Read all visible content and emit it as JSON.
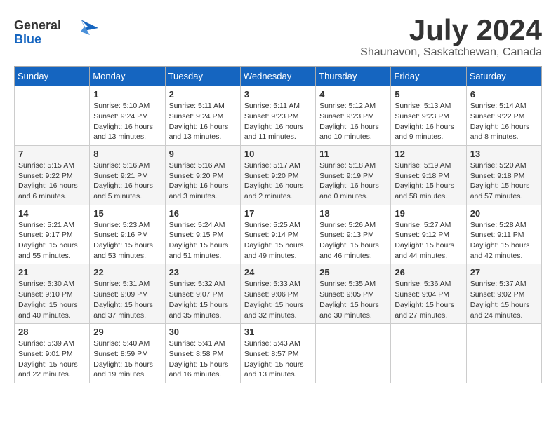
{
  "header": {
    "logo_line1": "General",
    "logo_line2": "Blue",
    "month": "July 2024",
    "location": "Shaunavon, Saskatchewan, Canada"
  },
  "weekdays": [
    "Sunday",
    "Monday",
    "Tuesday",
    "Wednesday",
    "Thursday",
    "Friday",
    "Saturday"
  ],
  "weeks": [
    [
      {
        "day": "",
        "info": ""
      },
      {
        "day": "1",
        "info": "Sunrise: 5:10 AM\nSunset: 9:24 PM\nDaylight: 16 hours\nand 13 minutes."
      },
      {
        "day": "2",
        "info": "Sunrise: 5:11 AM\nSunset: 9:24 PM\nDaylight: 16 hours\nand 13 minutes."
      },
      {
        "day": "3",
        "info": "Sunrise: 5:11 AM\nSunset: 9:23 PM\nDaylight: 16 hours\nand 11 minutes."
      },
      {
        "day": "4",
        "info": "Sunrise: 5:12 AM\nSunset: 9:23 PM\nDaylight: 16 hours\nand 10 minutes."
      },
      {
        "day": "5",
        "info": "Sunrise: 5:13 AM\nSunset: 9:23 PM\nDaylight: 16 hours\nand 9 minutes."
      },
      {
        "day": "6",
        "info": "Sunrise: 5:14 AM\nSunset: 9:22 PM\nDaylight: 16 hours\nand 8 minutes."
      }
    ],
    [
      {
        "day": "7",
        "info": "Sunrise: 5:15 AM\nSunset: 9:22 PM\nDaylight: 16 hours\nand 6 minutes."
      },
      {
        "day": "8",
        "info": "Sunrise: 5:16 AM\nSunset: 9:21 PM\nDaylight: 16 hours\nand 5 minutes."
      },
      {
        "day": "9",
        "info": "Sunrise: 5:16 AM\nSunset: 9:20 PM\nDaylight: 16 hours\nand 3 minutes."
      },
      {
        "day": "10",
        "info": "Sunrise: 5:17 AM\nSunset: 9:20 PM\nDaylight: 16 hours\nand 2 minutes."
      },
      {
        "day": "11",
        "info": "Sunrise: 5:18 AM\nSunset: 9:19 PM\nDaylight: 16 hours\nand 0 minutes."
      },
      {
        "day": "12",
        "info": "Sunrise: 5:19 AM\nSunset: 9:18 PM\nDaylight: 15 hours\nand 58 minutes."
      },
      {
        "day": "13",
        "info": "Sunrise: 5:20 AM\nSunset: 9:18 PM\nDaylight: 15 hours\nand 57 minutes."
      }
    ],
    [
      {
        "day": "14",
        "info": "Sunrise: 5:21 AM\nSunset: 9:17 PM\nDaylight: 15 hours\nand 55 minutes."
      },
      {
        "day": "15",
        "info": "Sunrise: 5:23 AM\nSunset: 9:16 PM\nDaylight: 15 hours\nand 53 minutes."
      },
      {
        "day": "16",
        "info": "Sunrise: 5:24 AM\nSunset: 9:15 PM\nDaylight: 15 hours\nand 51 minutes."
      },
      {
        "day": "17",
        "info": "Sunrise: 5:25 AM\nSunset: 9:14 PM\nDaylight: 15 hours\nand 49 minutes."
      },
      {
        "day": "18",
        "info": "Sunrise: 5:26 AM\nSunset: 9:13 PM\nDaylight: 15 hours\nand 46 minutes."
      },
      {
        "day": "19",
        "info": "Sunrise: 5:27 AM\nSunset: 9:12 PM\nDaylight: 15 hours\nand 44 minutes."
      },
      {
        "day": "20",
        "info": "Sunrise: 5:28 AM\nSunset: 9:11 PM\nDaylight: 15 hours\nand 42 minutes."
      }
    ],
    [
      {
        "day": "21",
        "info": "Sunrise: 5:30 AM\nSunset: 9:10 PM\nDaylight: 15 hours\nand 40 minutes."
      },
      {
        "day": "22",
        "info": "Sunrise: 5:31 AM\nSunset: 9:09 PM\nDaylight: 15 hours\nand 37 minutes."
      },
      {
        "day": "23",
        "info": "Sunrise: 5:32 AM\nSunset: 9:07 PM\nDaylight: 15 hours\nand 35 minutes."
      },
      {
        "day": "24",
        "info": "Sunrise: 5:33 AM\nSunset: 9:06 PM\nDaylight: 15 hours\nand 32 minutes."
      },
      {
        "day": "25",
        "info": "Sunrise: 5:35 AM\nSunset: 9:05 PM\nDaylight: 15 hours\nand 30 minutes."
      },
      {
        "day": "26",
        "info": "Sunrise: 5:36 AM\nSunset: 9:04 PM\nDaylight: 15 hours\nand 27 minutes."
      },
      {
        "day": "27",
        "info": "Sunrise: 5:37 AM\nSunset: 9:02 PM\nDaylight: 15 hours\nand 24 minutes."
      }
    ],
    [
      {
        "day": "28",
        "info": "Sunrise: 5:39 AM\nSunset: 9:01 PM\nDaylight: 15 hours\nand 22 minutes."
      },
      {
        "day": "29",
        "info": "Sunrise: 5:40 AM\nSunset: 8:59 PM\nDaylight: 15 hours\nand 19 minutes."
      },
      {
        "day": "30",
        "info": "Sunrise: 5:41 AM\nSunset: 8:58 PM\nDaylight: 15 hours\nand 16 minutes."
      },
      {
        "day": "31",
        "info": "Sunrise: 5:43 AM\nSunset: 8:57 PM\nDaylight: 15 hours\nand 13 minutes."
      },
      {
        "day": "",
        "info": ""
      },
      {
        "day": "",
        "info": ""
      },
      {
        "day": "",
        "info": ""
      }
    ]
  ]
}
